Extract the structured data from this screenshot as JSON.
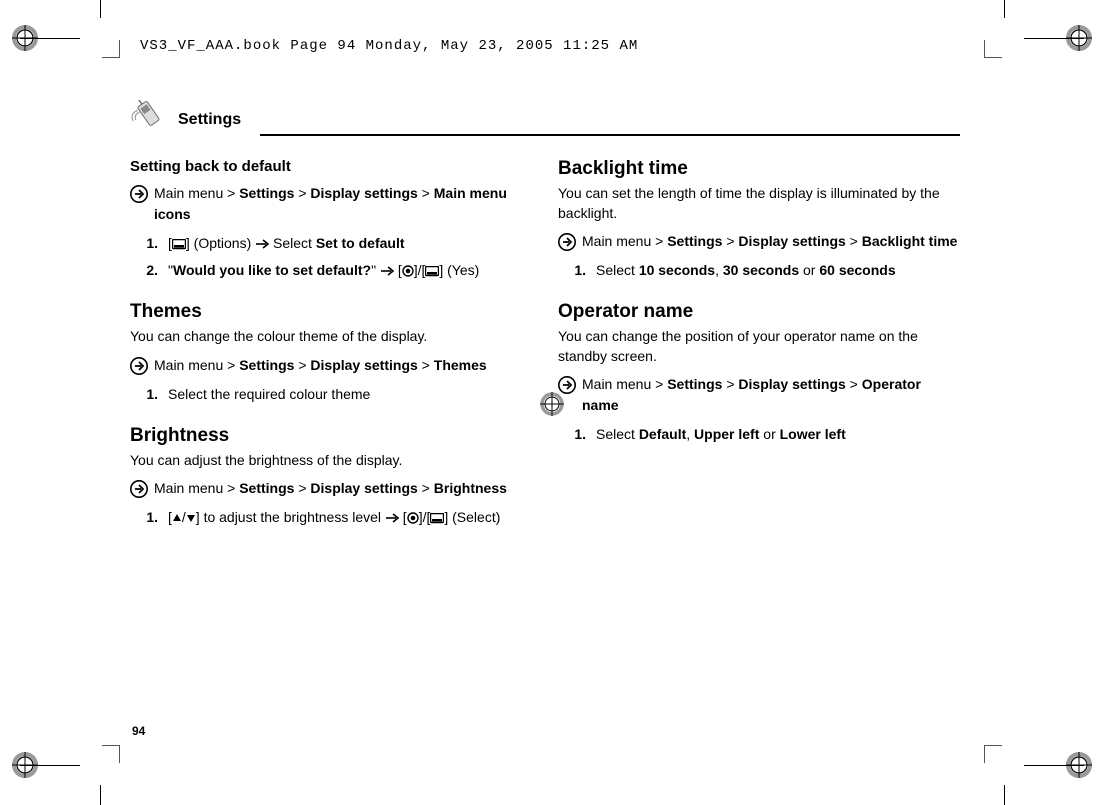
{
  "print_header": "VS3_VF_AAA.book  Page 94  Monday, May 23, 2005  11:25 AM",
  "page_title": "Settings",
  "page_number": "94",
  "left": {
    "s1": {
      "heading": "Setting back to default",
      "nav_prefix": "Main menu > ",
      "nav_b1": "Settings",
      "nav_b2": "Display settings",
      "nav_b3": "Main menu icons",
      "step1_num": "1.",
      "step1_options": "(Options)",
      "step1_select": "Select",
      "step1_bold": "Set to default",
      "step2_num": "2.",
      "step2_q": "Would you like to set default?",
      "step2_yes": "(Yes)"
    },
    "s2": {
      "heading": "Themes",
      "desc": "You can change the colour theme of the display.",
      "nav_prefix": "Main menu > ",
      "nav_b1": "Settings",
      "nav_b2": "Display settings",
      "nav_b3": "Themes",
      "step1_num": "1.",
      "step1_text": "Select the required colour theme"
    },
    "s3": {
      "heading": "Brightness",
      "desc": "You can adjust the brightness of the display.",
      "nav_prefix": "Main menu > ",
      "nav_b1": "Settings",
      "nav_b2": "Display settings",
      "nav_b3": "Brightness",
      "step1_num": "1.",
      "step1_mid": "to adjust the brightness level",
      "step1_select": "(Select)"
    }
  },
  "right": {
    "s1": {
      "heading": "Backlight time",
      "desc": "You can set the length of time the display is illuminated by the backlight.",
      "nav_prefix": "Main menu > ",
      "nav_b1": "Settings",
      "nav_b2": "Display settings",
      "nav_b3": "Backlight time",
      "step1_num": "1.",
      "step1_select": "Select",
      "step1_b1": "10 seconds",
      "step1_b2": "30 seconds",
      "step1_or": "or",
      "step1_b3": "60 seconds"
    },
    "s2": {
      "heading": "Operator name",
      "desc": "You can change the position of your operator name on the standby screen.",
      "nav_prefix": "Main menu > ",
      "nav_b1": "Settings",
      "nav_b2": "Display settings",
      "nav_b3": "Operator name",
      "step1_num": "1.",
      "step1_select": "Select",
      "step1_b1": "Default",
      "step1_b2": "Upper left",
      "step1_or": "or",
      "step1_b3": "Lower left"
    }
  }
}
